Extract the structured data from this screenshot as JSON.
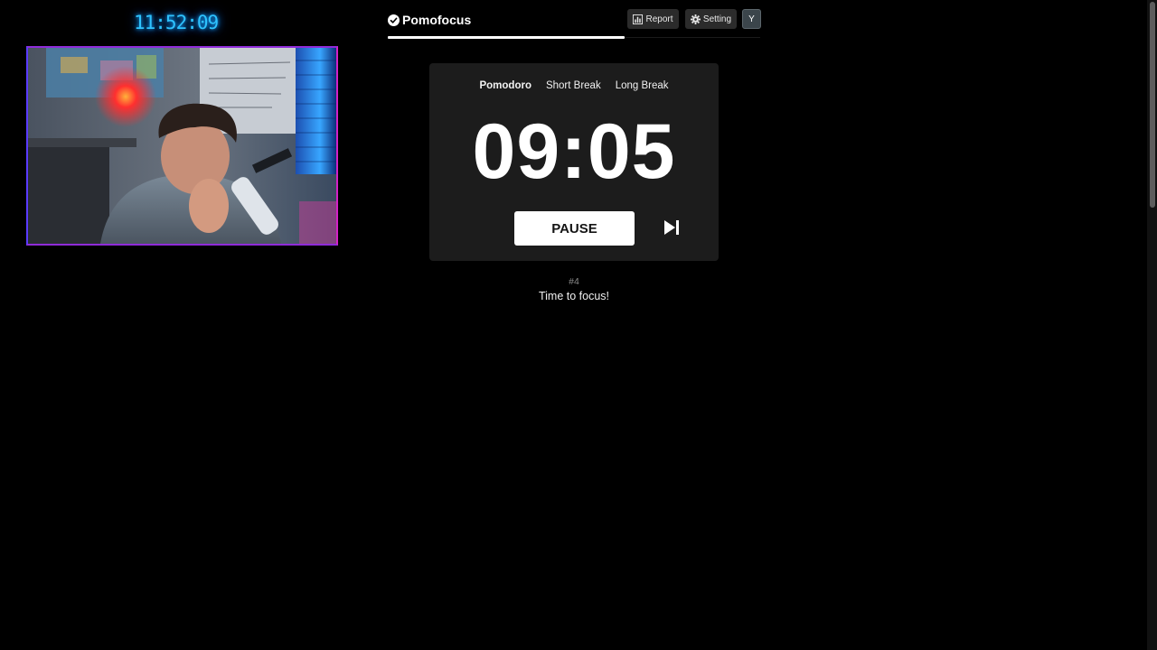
{
  "overlay": {
    "clock": "11:52:09",
    "clock_color": "#2ec3ff"
  },
  "webcam": {
    "content": "person-at-desk-webcam-feed",
    "frame_colors": [
      "#5a3bff",
      "#8f2bd8",
      "#d421c7"
    ]
  },
  "app": {
    "brand": "Pomofocus",
    "brand_icon": "check-circle-icon"
  },
  "header": {
    "progress": 0.635,
    "report_label": "Report",
    "report_icon": "bar-chart-icon",
    "setting_label": "Setting",
    "setting_icon": "gear-icon",
    "avatar_initial": "Y"
  },
  "timer": {
    "tabs": [
      {
        "label": "Pomodoro",
        "active": true
      },
      {
        "label": "Short Break",
        "active": false
      },
      {
        "label": "Long Break",
        "active": false
      }
    ],
    "time": "09:05",
    "action_label": "PAUSE",
    "skip_icon": "skip-next-icon"
  },
  "session": {
    "counter": "#4",
    "message": "Time to focus!"
  },
  "colors": {
    "background": "#000000",
    "card": "#1c1c1c",
    "button_bg": "#2b2b2b",
    "accent": "#ffffff"
  }
}
